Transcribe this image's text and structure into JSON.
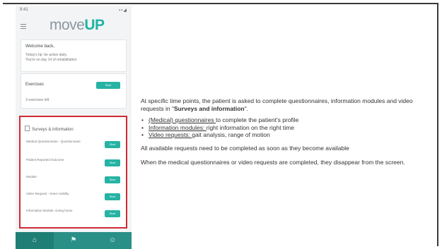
{
  "phone": {
    "status_time": "9:41",
    "status_icons": "▪▪◢",
    "logo_prefix": "move",
    "logo_suffix": "UP",
    "card1_lines": [
      "Welcome back,",
      "Today's tip: be active daily.",
      "You're on day 14 of rehabilitation"
    ],
    "card2_title": "Exercises",
    "card2_button": "Start",
    "card2_sub": "3 exercises left",
    "surveys_title": "Surveys & information",
    "survey_items": [
      {
        "label": "Medical Questionnaire - Questionnaire",
        "button": "Start"
      },
      {
        "label": "Patient Reported Outcome",
        "button": "Start"
      },
      {
        "label": "Module",
        "button": "Start"
      },
      {
        "label": "Video Request - Knee mobility",
        "button": "Start"
      },
      {
        "label": "Information Module: Going home",
        "button": "Start"
      }
    ],
    "nav": [
      {
        "icon": "⌂",
        "name": "home"
      },
      {
        "icon": "⚑",
        "name": "activity"
      },
      {
        "icon": "☺",
        "name": "profile"
      }
    ]
  },
  "description": {
    "intro_1": "At specific time points, the patient is asked to complete questionnaires, information modules and video requests in \"",
    "intro_bold": "Surveys and information",
    "intro_2": "\".",
    "bullets": [
      {
        "key": "(Medical) questionnaires ",
        "text": "to complete the patient's profile"
      },
      {
        "key": "Information modules: ",
        "text": "right information on the right time"
      },
      {
        "key": "Video requests: ",
        "text": "gait analysis, range of motion"
      }
    ],
    "para1": "All available requests need to be completed as soon as they become available",
    "para2": "When the medical questionnaires or video requests are completed, they disappear from the screen."
  }
}
